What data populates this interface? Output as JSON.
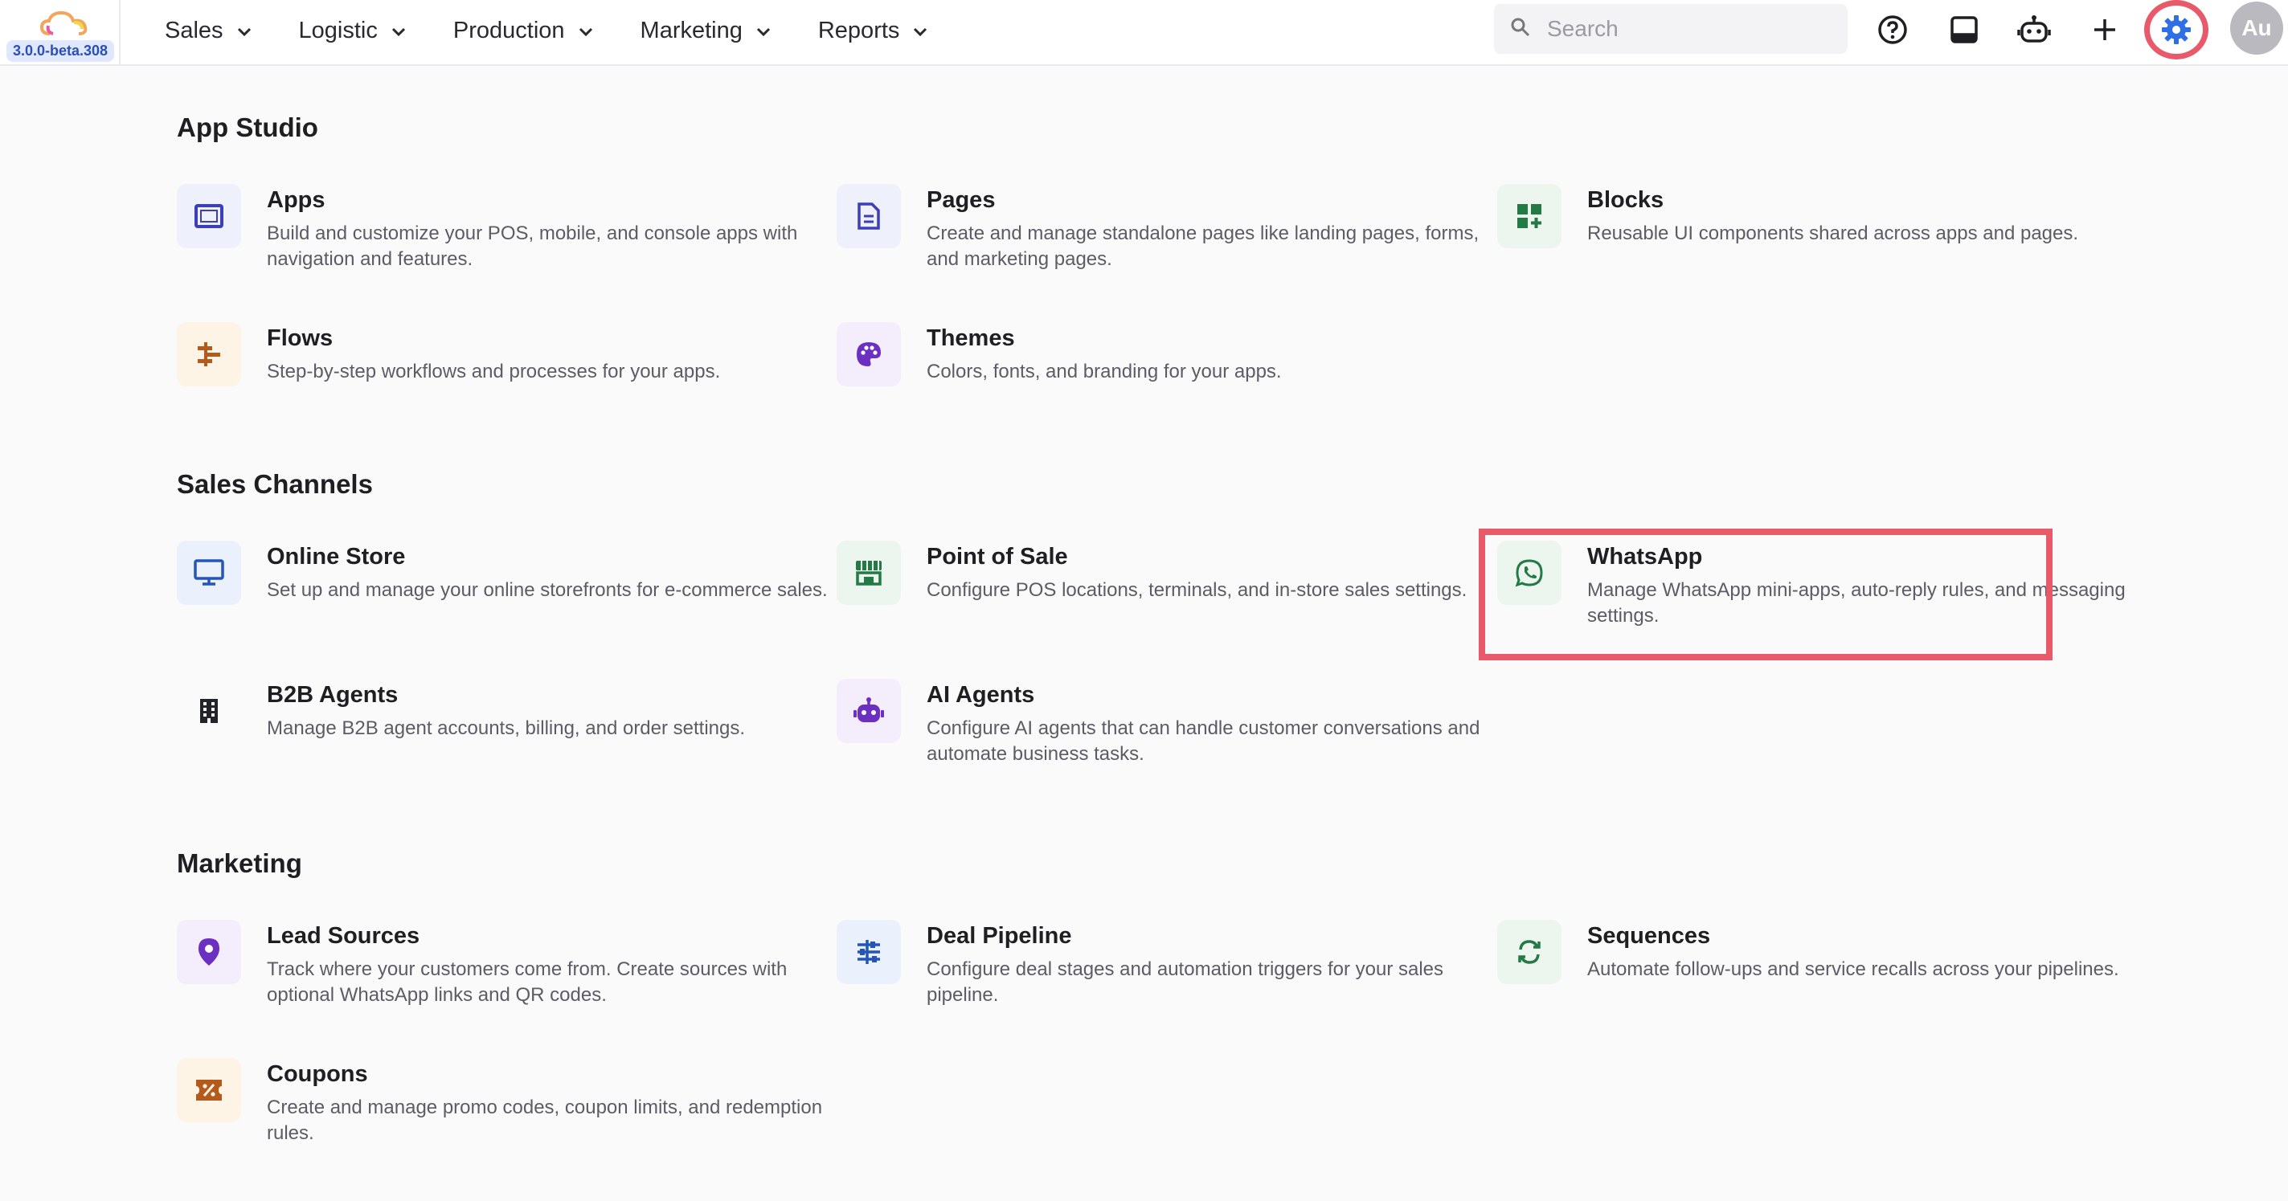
{
  "app": {
    "version": "3.0.0-beta.308"
  },
  "nav": [
    {
      "label": "Sales"
    },
    {
      "label": "Logistic"
    },
    {
      "label": "Production"
    },
    {
      "label": "Marketing"
    },
    {
      "label": "Reports"
    }
  ],
  "search": {
    "placeholder": "Search"
  },
  "header_icons": [
    "help-icon",
    "inbox-icon",
    "robot-icon",
    "plus-icon",
    "gear-icon"
  ],
  "user": {
    "initials": "Au"
  },
  "colors": {
    "highlight": "#e85a6a",
    "accent_blue": "#2f6fe6",
    "avatar": "#b9b9bf"
  },
  "sections": {
    "app_studio": {
      "title": "App Studio",
      "cards": [
        {
          "title": "Apps",
          "description": "Build and customize your POS, mobile, and console apps with navigation and features.",
          "icon": "app-window-icon"
        },
        {
          "title": "Pages",
          "description": "Create and manage standalone pages like landing pages, forms, and marketing pages.",
          "icon": "document-icon"
        },
        {
          "title": "Blocks",
          "description": "Reusable UI components shared across apps and pages.",
          "icon": "blocks-icon"
        },
        {
          "title": "Flows",
          "description": "Step-by-step workflows and processes for your apps.",
          "icon": "flow-icon"
        },
        {
          "title": "Themes",
          "description": "Colors, fonts, and branding for your apps.",
          "icon": "palette-icon"
        }
      ]
    },
    "sales_channels": {
      "title": "Sales Channels",
      "cards": [
        {
          "title": "Online Store",
          "description": "Set up and manage your online storefronts for e-commerce sales.",
          "icon": "monitor-icon"
        },
        {
          "title": "Point of Sale",
          "description": "Configure POS locations, terminals, and in-store sales settings.",
          "icon": "storefront-icon"
        },
        {
          "title": "WhatsApp",
          "description": "Manage WhatsApp mini-apps, auto-reply rules, and messaging settings.",
          "icon": "whatsapp-icon"
        },
        {
          "title": "B2B Agents",
          "description": "Manage B2B agent accounts, billing, and order settings.",
          "icon": "building-icon"
        },
        {
          "title": "AI Agents",
          "description": "Configure AI agents that can handle customer conversations and automate business tasks.",
          "icon": "robot-icon"
        }
      ]
    },
    "marketing": {
      "title": "Marketing",
      "cards": [
        {
          "title": "Lead Sources",
          "description": "Track where your customers come from. Create sources with optional WhatsApp links and QR codes.",
          "icon": "location-pin-icon"
        },
        {
          "title": "Deal Pipeline",
          "description": "Configure deal stages and automation triggers for your sales pipeline.",
          "icon": "pipeline-icon"
        },
        {
          "title": "Sequences",
          "description": "Automate follow-ups and service recalls across your pipelines.",
          "icon": "refresh-icon"
        },
        {
          "title": "Coupons",
          "description": "Create and manage promo codes, coupon limits, and redemption rules.",
          "icon": "coupon-icon"
        }
      ]
    }
  }
}
